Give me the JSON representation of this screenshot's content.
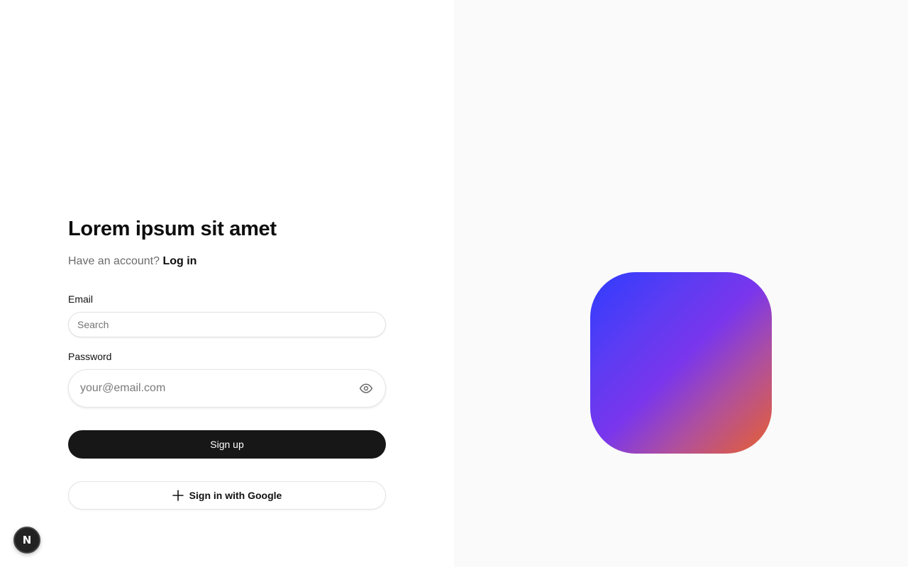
{
  "form": {
    "title": "Lorem ipsum sit amet",
    "subtitle_prefix": "Have an account?",
    "login_link": "Log in",
    "email_label": "Email",
    "email_placeholder": "Search",
    "email_value": "",
    "password_label": "Password",
    "password_placeholder": "your@email.com",
    "password_value": "",
    "password_toggle_icon": "eye-icon",
    "signup_button": "Sign up",
    "google_button": "Sign in with Google",
    "google_button_icon": "plus-icon"
  },
  "hero": {
    "tile_gradient": [
      "#2f3cff",
      "#7a36ec",
      "#e8602e"
    ]
  },
  "badge": {
    "letter": "N",
    "icon": "nextjs-logo-icon"
  },
  "colors": {
    "primary_button": "#171717",
    "right_panel_bg": "#fafafa"
  }
}
